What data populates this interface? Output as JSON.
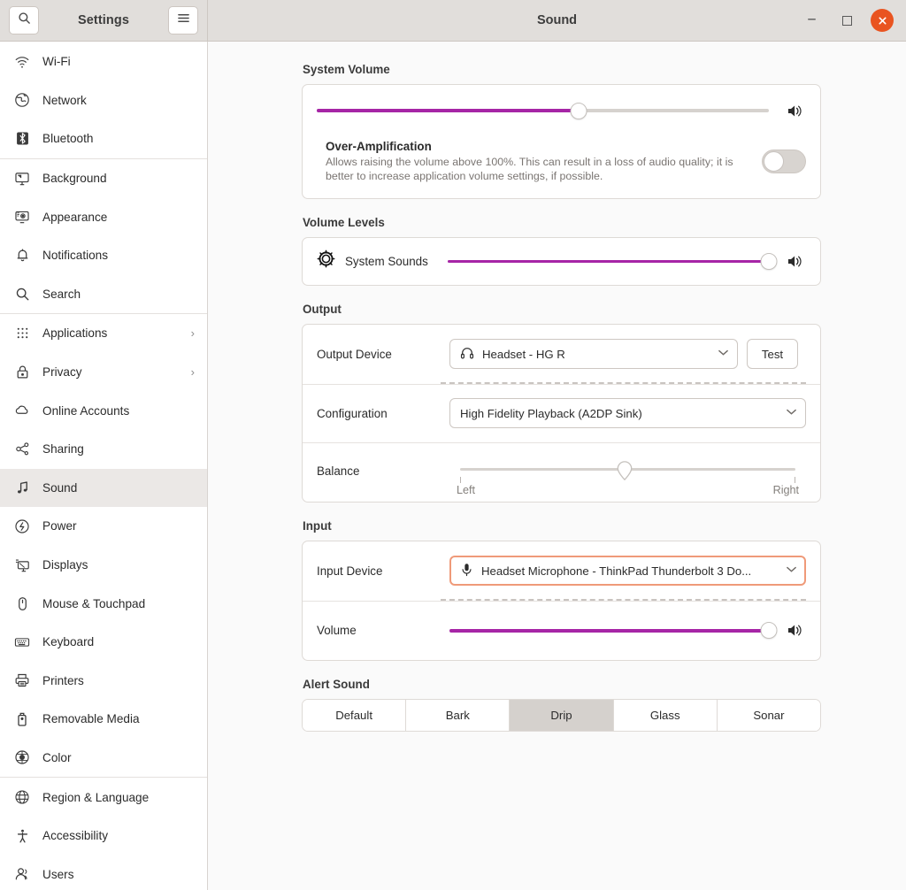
{
  "titlebar": {
    "settings_title": "Settings",
    "window_title": "Sound",
    "search_icon": "search-icon",
    "menu_icon": "hamburger-menu-icon",
    "minimize_label": "—",
    "maximize_label": "",
    "close_label": "×",
    "close_color": "#e95420"
  },
  "sidebar": {
    "items": [
      {
        "label": "Wi-Fi",
        "icon": "wifi-icon",
        "chevron": "",
        "selected": false,
        "sep_after": false
      },
      {
        "label": "Network",
        "icon": "network-globe-icon",
        "chevron": "",
        "selected": false,
        "sep_after": false
      },
      {
        "label": "Bluetooth",
        "icon": "bluetooth-icon",
        "chevron": "",
        "selected": false,
        "sep_after": true
      },
      {
        "label": "Background",
        "icon": "background-icon",
        "chevron": "",
        "selected": false,
        "sep_after": false
      },
      {
        "label": "Appearance",
        "icon": "appearance-icon",
        "chevron": "",
        "selected": false,
        "sep_after": false
      },
      {
        "label": "Notifications",
        "icon": "bell-icon",
        "chevron": "",
        "selected": false,
        "sep_after": false
      },
      {
        "label": "Search",
        "icon": "search-icon",
        "chevron": "",
        "selected": false,
        "sep_after": true
      },
      {
        "label": "Applications",
        "icon": "grid-apps-icon",
        "chevron": "›",
        "selected": false,
        "sep_after": false
      },
      {
        "label": "Privacy",
        "icon": "lock-icon",
        "chevron": "›",
        "selected": false,
        "sep_after": false
      },
      {
        "label": "Online Accounts",
        "icon": "cloud-icon",
        "chevron": "",
        "selected": false,
        "sep_after": false
      },
      {
        "label": "Sharing",
        "icon": "share-icon",
        "chevron": "",
        "selected": false,
        "sep_after": false
      },
      {
        "label": "Sound",
        "icon": "music-note-icon",
        "chevron": "",
        "selected": true,
        "sep_after": false
      },
      {
        "label": "Power",
        "icon": "power-icon",
        "chevron": "",
        "selected": false,
        "sep_after": false
      },
      {
        "label": "Displays",
        "icon": "displays-icon",
        "chevron": "",
        "selected": false,
        "sep_after": false
      },
      {
        "label": "Mouse & Touchpad",
        "icon": "mouse-icon",
        "chevron": "",
        "selected": false,
        "sep_after": false
      },
      {
        "label": "Keyboard",
        "icon": "keyboard-icon",
        "chevron": "",
        "selected": false,
        "sep_after": false
      },
      {
        "label": "Printers",
        "icon": "printer-icon",
        "chevron": "",
        "selected": false,
        "sep_after": false
      },
      {
        "label": "Removable Media",
        "icon": "usb-drive-icon",
        "chevron": "",
        "selected": false,
        "sep_after": false
      },
      {
        "label": "Color",
        "icon": "color-wheel-icon",
        "chevron": "",
        "selected": false,
        "sep_after": true
      },
      {
        "label": "Region & Language",
        "icon": "globe-icon",
        "chevron": "",
        "selected": false,
        "sep_after": false
      },
      {
        "label": "Accessibility",
        "icon": "accessibility-icon",
        "chevron": "",
        "selected": false,
        "sep_after": false
      },
      {
        "label": "Users",
        "icon": "users-icon",
        "chevron": "",
        "selected": false,
        "sep_after": false
      }
    ]
  },
  "main": {
    "system_volume": {
      "title": "System Volume",
      "slider_percent": 58,
      "speaker_icon": "speaker-volume-icon",
      "over_amplification": {
        "title": "Over-Amplification",
        "description": "Allows raising the volume above 100%. This can result in a loss of audio quality; it is better to increase application volume settings, if possible.",
        "enabled": false
      }
    },
    "volume_levels": {
      "title": "Volume Levels",
      "apps": [
        {
          "name": "System Sounds",
          "icon": "gear-icon",
          "slider_percent": 100,
          "speaker_icon": "speaker-volume-icon"
        }
      ]
    },
    "output": {
      "title": "Output",
      "device_label": "Output Device",
      "device_value": "Headset - HG R",
      "device_icon": "headphones-icon",
      "test_label": "Test",
      "configuration_label": "Configuration",
      "configuration_value": "High Fidelity Playback (A2DP Sink)",
      "balance_label": "Balance",
      "balance_percent": 50,
      "balance_left_label": "Left",
      "balance_right_label": "Right"
    },
    "input": {
      "title": "Input",
      "device_label": "Input Device",
      "device_value": "Headset Microphone - ThinkPad Thunderbolt 3 Do...",
      "device_icon": "microphone-icon",
      "device_focused": true,
      "focus_color": "#ef9a79",
      "volume_label": "Volume",
      "volume_percent": 100,
      "speaker_icon": "speaker-volume-icon"
    },
    "alert_sound": {
      "title": "Alert Sound",
      "options": [
        "Default",
        "Bark",
        "Drip",
        "Glass",
        "Sonar"
      ],
      "selected": "Drip"
    }
  },
  "theme": {
    "accent_slider": "#a625a6",
    "selection_bg": "#ebe8e6",
    "titlebar_bg": "#e1dedb",
    "content_bg": "#fafafa"
  }
}
